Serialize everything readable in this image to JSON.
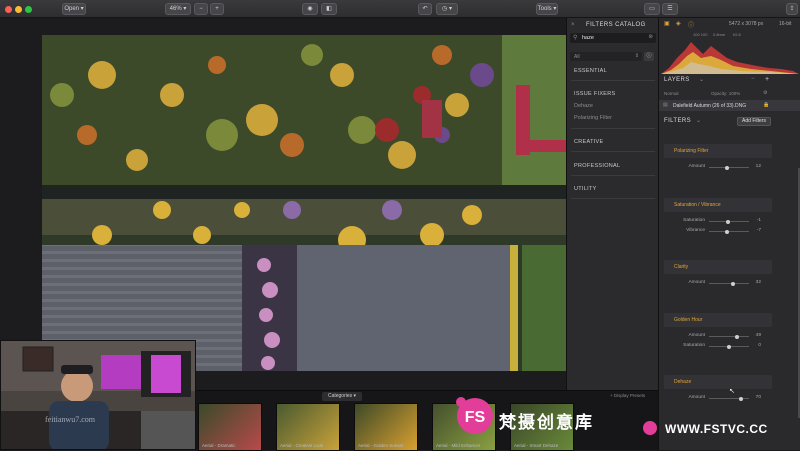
{
  "toolbar": {
    "open_label": "Open",
    "zoom_label": "46%",
    "tools_label": "Tools"
  },
  "catalog": {
    "title": "FILTERS CATALOG",
    "search_value": "haze",
    "filter_all": "All",
    "sections": [
      {
        "label": "ESSENTIAL"
      },
      {
        "label": "ISSUE FIXERS",
        "items": [
          "Dehaze",
          "Polarizing Filter"
        ]
      },
      {
        "label": "CREATIVE"
      },
      {
        "label": "PROFESSIONAL"
      },
      {
        "label": "UTILITY"
      }
    ]
  },
  "histogram": {
    "size_text": "5472 x 3078 px",
    "bit_depth": "16-bit",
    "exif": [
      "100 100",
      "0.8mm",
      "f/2.8"
    ]
  },
  "layers": {
    "title": "LAYERS",
    "blend": "Normal",
    "opacity": "Opacity: 100%",
    "layer_name": "Dalefield Autumn (26 of 33).DNG"
  },
  "filters": {
    "title": "FILTERS",
    "add_label": "Add Filters",
    "groups": [
      {
        "name": "Polarizing Filter",
        "sliders": [
          {
            "label": "Amount",
            "value": "12",
            "pos": 0.45
          }
        ]
      },
      {
        "name": "Saturation / Vibrance",
        "sliders": [
          {
            "label": "Saturation",
            "value": "-1",
            "pos": 0.48
          },
          {
            "label": "Vibrance",
            "value": "-7",
            "pos": 0.44
          }
        ]
      },
      {
        "name": "Clarity",
        "sliders": [
          {
            "label": "Amount",
            "value": "32",
            "pos": 0.6
          }
        ]
      },
      {
        "name": "Golden Hour",
        "sliders": [
          {
            "label": "Amount",
            "value": "49",
            "pos": 0.7
          },
          {
            "label": "Saturation",
            "value": "0",
            "pos": 0.5
          }
        ]
      },
      {
        "name": "Dehaze",
        "sliders": [
          {
            "label": "Amount",
            "value": "70",
            "pos": 0.8
          }
        ]
      }
    ]
  },
  "strip": {
    "categories_label": "Categories",
    "display_presets": "+ Display Presets",
    "thumbs": [
      "Aerial - Dramatic",
      "Aerial - Creative Look",
      "Aerial - Golden Sunset",
      "Aerial - Mild Enhancer",
      "Aerial - Smart Dehaze"
    ]
  },
  "watermark": {
    "site": "feitianwu7.com",
    "brand": "梵摄创意库",
    "url": "WWW.FSTVC.CC",
    "logo_letter": "FS"
  },
  "colors": {
    "accent": "#e0a437",
    "brand_pink": "#e33d9a"
  }
}
